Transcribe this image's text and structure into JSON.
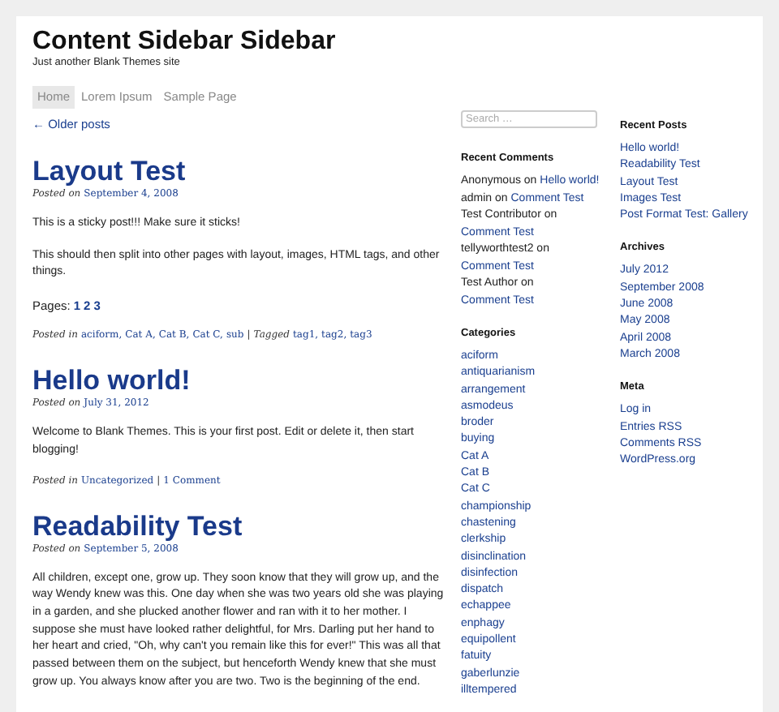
{
  "site": {
    "title": "Content Sidebar Sidebar",
    "tagline": "Just another Blank Themes site"
  },
  "nav": [
    {
      "label": "Home",
      "selected": true
    },
    {
      "label": "Lorem Ipsum",
      "selected": false
    },
    {
      "label": "Sample Page",
      "selected": false
    }
  ],
  "older_link": "← Older posts",
  "posts": [
    {
      "title": "Layout Test",
      "posted_label": "Posted on",
      "date": "September 4, 2008",
      "body": [
        {
          "kind": "text",
          "text": "This is a sticky post!!! Make sure it sticks!"
        },
        {
          "kind": "text",
          "text": "This should then split into other pages with layout, images, HTML tags, and other things."
        },
        {
          "kind": "pages",
          "label": "Pages:",
          "links": [
            "1",
            "2",
            "3"
          ]
        }
      ],
      "footer": {
        "posted_in_label": "Posted in",
        "categories": [
          "aciform,",
          "Cat A,",
          "Cat B,",
          "Cat C,",
          "sub"
        ],
        "separator": "|",
        "tagged_label": "Tagged",
        "tags": [
          "tag1,",
          "tag2,",
          "tag3"
        ]
      }
    },
    {
      "title": "Hello world!",
      "posted_label": "Posted on",
      "date": "July 31, 2012",
      "body": [
        {
          "kind": "text",
          "text": "Welcome to Blank Themes. This is your first post. Edit or delete it, then start blogging!"
        }
      ],
      "footer": {
        "posted_in_label": "Posted in",
        "categories": [
          "Uncategorized"
        ],
        "separator": "|",
        "comments": "1 Comment"
      }
    },
    {
      "title": "Readability Test",
      "posted_label": "Posted on",
      "date": "September 5, 2008",
      "body": [
        {
          "kind": "text",
          "text": "All children, except one, grow up. They soon know that they will grow up, and the way Wendy knew was this. One day when she was two years old she was playing in a garden, and she plucked another flower and ran with it to her mother. I suppose she must have looked rather delightful, for Mrs. Darling put her hand to her heart and cried, \"Oh, why can't you remain like this for ever!\" This was all that passed between them on the subject, but henceforth Wendy knew that she must grow up. You always know after you are two. Two is the beginning of the end."
        }
      ]
    }
  ],
  "sidebar_1": {
    "search": {
      "placeholder": "Search …"
    },
    "recent_comments": {
      "title": "Recent Comments",
      "items": [
        {
          "author": "Anonymous on",
          "link": "Hello world!"
        },
        {
          "author": "admin on",
          "link": "Comment Test"
        },
        {
          "author": "Test Contributor on",
          "link": "Comment Test"
        },
        {
          "author": "tellyworthtest2 on",
          "link": "Comment Test"
        },
        {
          "author": "Test Author on",
          "link": "Comment Test"
        }
      ]
    },
    "categories": {
      "title": "Categories",
      "items": [
        "aciform",
        "antiquarianism",
        "arrangement",
        "asmodeus",
        "broder",
        "buying",
        "Cat A",
        "Cat B",
        "Cat C",
        "championship",
        "chastening",
        "clerkship",
        "disinclination",
        "disinfection",
        "dispatch",
        "echappee",
        "enphagy",
        "equipollent",
        "fatuity",
        "gaberlunzie",
        "illtempered"
      ]
    }
  },
  "sidebar_2": {
    "recent_posts": {
      "title": "Recent Posts",
      "items": [
        "Hello world!",
        "Readability Test",
        "Layout Test",
        "Images Test",
        "Post Format Test: Gallery"
      ]
    },
    "archives": {
      "title": "Archives",
      "items": [
        "July 2012",
        "September 2008",
        "June 2008",
        "May 2008",
        "April 2008",
        "March 2008"
      ]
    },
    "meta": {
      "title": "Meta",
      "items": [
        "Log in",
        "Entries RSS",
        "Comments RSS",
        "WordPress.org"
      ]
    }
  }
}
